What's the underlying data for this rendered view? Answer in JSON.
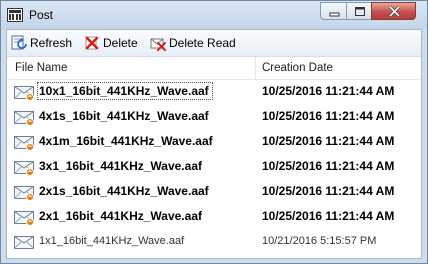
{
  "window": {
    "title": "Post"
  },
  "toolbar": {
    "refresh_label": "Refresh",
    "delete_label": "Delete",
    "delete_read_label": "Delete Read"
  },
  "columns": {
    "file_name": "File Name",
    "creation_date": "Creation Date"
  },
  "rows": [
    {
      "name": "10x1_16bit_441KHz_Wave.aaf",
      "date": "10/25/2016 11:21:44 AM",
      "unread": true,
      "selected": true
    },
    {
      "name": "4x1s_16bit_441KHz_Wave.aaf",
      "date": "10/25/2016 11:21:44 AM",
      "unread": true
    },
    {
      "name": "4x1m_16bit_441KHz_Wave.aaf",
      "date": "10/25/2016 11:21:44 AM",
      "unread": true
    },
    {
      "name": "3x1_16bit_441KHz_Wave.aaf",
      "date": "10/25/2016 11:21:44 AM",
      "unread": true
    },
    {
      "name": "2x1s_16bit_441KHz_Wave.aaf",
      "date": "10/25/2016 11:21:44 AM",
      "unread": true
    },
    {
      "name": "2x1_16bit_441KHz_Wave.aaf",
      "date": "10/25/2016 11:21:44 AM",
      "unread": true
    },
    {
      "name": "1x1_16bit_441KHz_Wave.aaf",
      "date": "10/21/2016 5:15:57 PM",
      "unread": false
    }
  ],
  "colors": {
    "unread_badge": "#e87a00",
    "delete_red": "#d42020",
    "title_bar": "#c4d5e8"
  },
  "icons": [
    "app-icon",
    "minimize-icon",
    "maximize-icon",
    "close-icon",
    "refresh-icon",
    "delete-icon",
    "delete-read-icon",
    "unread-mail-icon",
    "read-mail-icon"
  ]
}
